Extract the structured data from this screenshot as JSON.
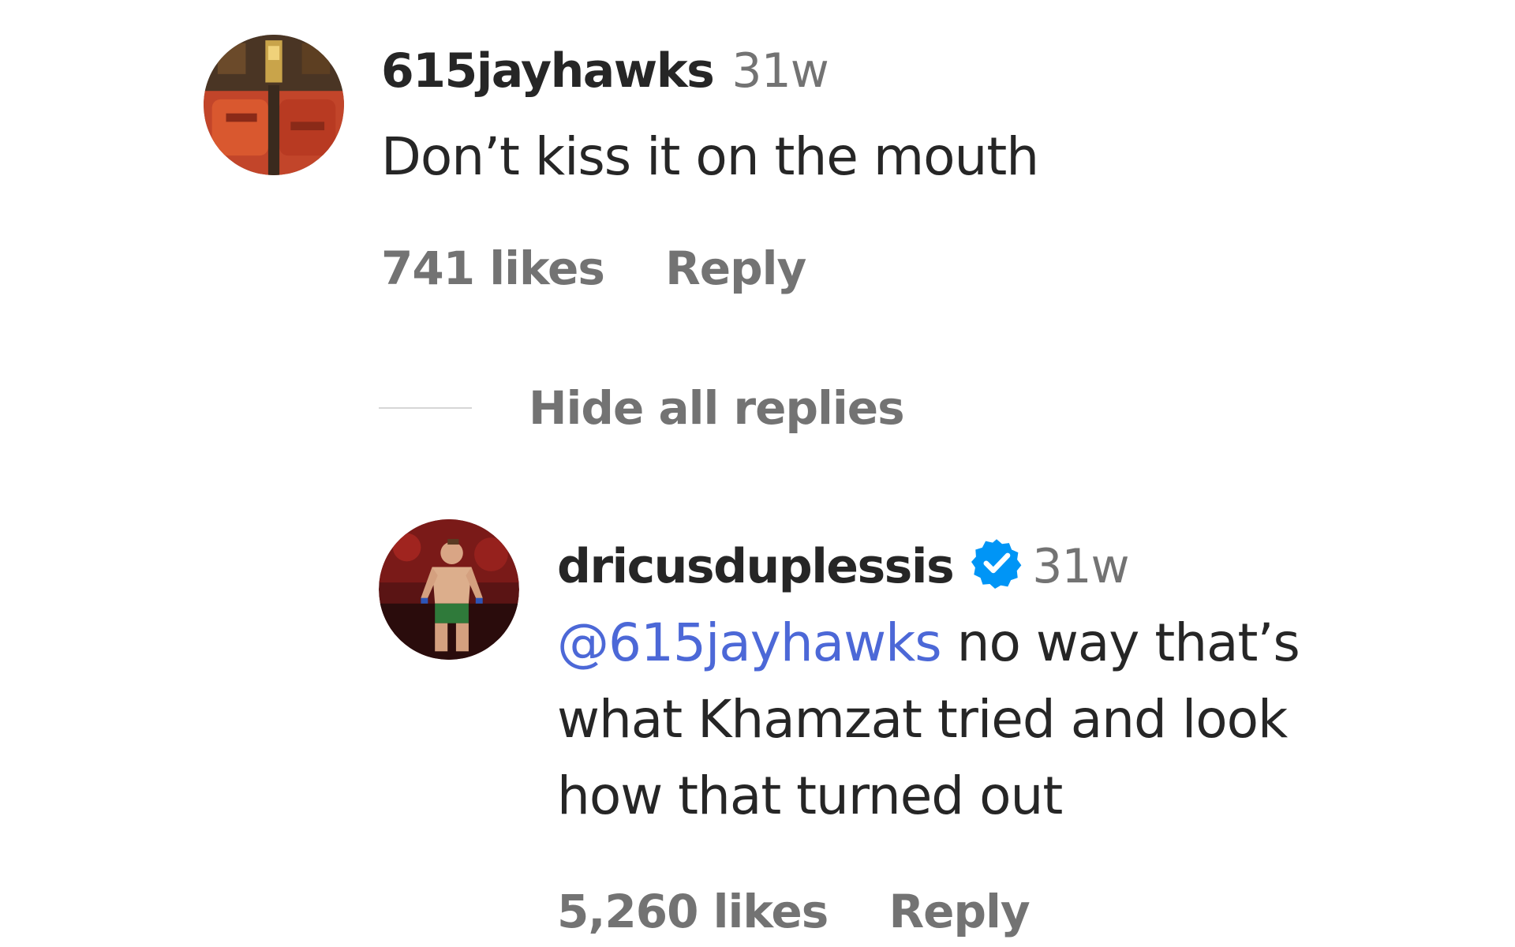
{
  "comments": [
    {
      "username": "615jayhawks",
      "timestamp": "31w",
      "text": "Don’t kiss it on the mouth",
      "likes": "741 likes",
      "reply_label": "Reply",
      "avatar_icon": "user-avatar-icon"
    }
  ],
  "thread": {
    "hide_replies_label": "Hide all replies"
  },
  "replies": [
    {
      "username": "dricusduplessis",
      "verified": true,
      "verified_icon": "verified-badge-icon",
      "verified_color": "#0095f6",
      "timestamp": "31w",
      "mention": "@615jayhawks",
      "text": " no way that’s what Khamzat tried and look how that turned out",
      "likes": "5,260 likes",
      "reply_label": "Reply",
      "avatar_icon": "user-avatar-icon"
    }
  ],
  "colors": {
    "username": "#262626",
    "secondary": "#737373",
    "mention": "#4c68d7"
  }
}
